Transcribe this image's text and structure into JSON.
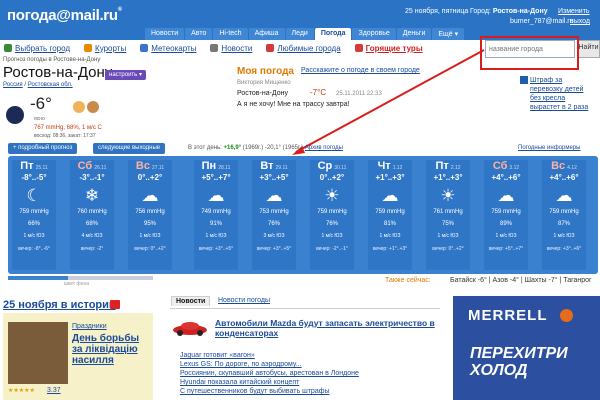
{
  "header": {
    "logo": "погода@mail.ru",
    "date": "25 ноября, пятница",
    "city_label": "Город:",
    "city": "Ростов-на-Дону",
    "change": "Изменить",
    "user": "bumer_787@mail.ru",
    "exit": "выход"
  },
  "tabs": [
    "Новости",
    "Авто",
    "Hi-tech",
    "Афиша",
    "Леди",
    "Погода",
    "Здоровье",
    "Деньги",
    "Ещё ▾"
  ],
  "active_tab": "Погода",
  "subnav": [
    {
      "label": "Выбрать город",
      "icon": "globe-icon",
      "color": "#3a8a3a"
    },
    {
      "label": "Курорты",
      "icon": "palm-icon",
      "color": "#e68a00"
    },
    {
      "label": "Метеокарты",
      "icon": "map-icon",
      "color": "#3a73c8"
    },
    {
      "label": "Новости",
      "icon": "news-icon",
      "color": "#777777"
    },
    {
      "label": "Любимые города",
      "icon": "heart-icon",
      "color": "#d43a3a"
    },
    {
      "label": "Горящие туры",
      "icon": "fire-icon",
      "color": "#d43a3a"
    }
  ],
  "search": {
    "placeholder": "название города",
    "button": "Найти"
  },
  "location": {
    "crumb": "Прогноз погоды в Ростове-на-Дону",
    "name": "Ростов-на-Дону",
    "settings": "настроить ▾",
    "region1": "Россия",
    "region2": "Ростовская обл."
  },
  "current": {
    "temp": "-6°",
    "condition": "ясно",
    "pressure": "767 mmHg, 68%, 1 м/с С",
    "sun": "восход: 08:36, закат: 17:37"
  },
  "my_weather": {
    "title": "Моя погода",
    "link": "Расскажите о погоде в своем городе",
    "user": "Виктория Мищенко",
    "city": "Ростов-на-Дону",
    "temp": "-7°С",
    "time": "25.11.2011 22:33",
    "quote": "А я не хочу! Мне на трассу завтра!"
  },
  "banner": {
    "text": "Штраф за перевозку детей без кресла вырастет в 2 раза"
  },
  "buttons": {
    "detailed": "+ подробный прогноз",
    "weekend": "следующие выходные"
  },
  "day_note": {
    "prefix": "В этот день:",
    "max": "+16,9°",
    "max_year": "(1969г.)",
    "min": "-20,1°",
    "min_year": "(1965г.)",
    "archive": "Архив погоды"
  },
  "informers": "Погодные информеры",
  "days": [
    {
      "name": "Пт",
      "date": "25.11",
      "temp": "-8°..-5°",
      "icon": "☾",
      "pressure": "759 mmHg",
      "humidity": "66%",
      "wind": "1 м/с ЮЗ",
      "evening": "вечер: -8°..-6°",
      "weekend": false
    },
    {
      "name": "Сб",
      "date": "26.11",
      "temp": "-3°..-1°",
      "icon": "❄",
      "pressure": "760 mmHg",
      "humidity": "68%",
      "wind": "4 м/с ЮЗ",
      "evening": "вечер: -2°",
      "weekend": true
    },
    {
      "name": "Вс",
      "date": "27.11",
      "temp": "0°..+2°",
      "icon": "☁",
      "pressure": "756 mmHg",
      "humidity": "95%",
      "wind": "1 м/с ЮЗ",
      "evening": "вечер: 0°..+2°",
      "weekend": true
    },
    {
      "name": "Пн",
      "date": "28.11",
      "temp": "+5°..+7°",
      "icon": "☁",
      "pressure": "749 mmHg",
      "humidity": "91%",
      "wind": "1 м/с ЮЗ",
      "evening": "вечер: +3°..+5°",
      "weekend": false
    },
    {
      "name": "Вт",
      "date": "29.11",
      "temp": "+3°..+5°",
      "icon": "☁",
      "pressure": "753 mmHg",
      "humidity": "76%",
      "wind": "3 м/с ЮЗ",
      "evening": "вечер: +3°..+5°",
      "weekend": false
    },
    {
      "name": "Ср",
      "date": "30.11",
      "temp": "0°..+2°",
      "icon": "☀",
      "pressure": "759 mmHg",
      "humidity": "76%",
      "wind": "1 м/с ЮЗ",
      "evening": "вечер: -2°..-1°",
      "weekend": false
    },
    {
      "name": "Чт",
      "date": "1.12",
      "temp": "+1°..+3°",
      "icon": "☁",
      "pressure": "759 mmHg",
      "humidity": "81%",
      "wind": "1 м/с ЮЗ",
      "evening": "вечер: +1°..+3°",
      "weekend": false
    },
    {
      "name": "Пт",
      "date": "2.12",
      "temp": "+1°..+3°",
      "icon": "☀",
      "pressure": "761 mmHg",
      "humidity": "75%",
      "wind": "1 м/с ЮЗ",
      "evening": "вечер: 0°..+2°",
      "weekend": false
    },
    {
      "name": "Сб",
      "date": "3.12",
      "temp": "+4°..+6°",
      "icon": "☁",
      "pressure": "759 mmHg",
      "humidity": "89%",
      "wind": "1 м/с ЮЗ",
      "evening": "вечер: +5°..+7°",
      "weekend": true
    },
    {
      "name": "Вс",
      "date": "4.12",
      "temp": "+4°..+6°",
      "icon": "☁",
      "pressure": "759 mmHg",
      "humidity": "87%",
      "wind": "1 м/с ЮЗ",
      "evening": "вечер: +3°..+6°",
      "weekend": true
    }
  ],
  "scale": "шкет фона",
  "also": {
    "label": "Также сейчас:",
    "items": "Батайск -6° | Азов -4° | Шахты -7° | Таганрог"
  },
  "history": {
    "title": "25 ноября в истории",
    "category": "Праздники",
    "headline": "День борьбы за ліквідацію насилля",
    "rating": "3.37"
  },
  "news": {
    "tab1": "Новости",
    "tab2": "Новости погоды",
    "main": "Автомобили Mazda будут запасать электричество в конденсаторах",
    "items": [
      "Jaguar готовит «вагон»",
      "Lexus GS: По дороге, по аэродрому...",
      "Россиянин, скупавший автобусы, арестован в Лондоне",
      "Hyundai показала китайский концепт",
      "С путешественников будут выбивать штрафы"
    ]
  },
  "ad": {
    "brand": "MERRELL",
    "slogan": "ПЕРЕХИТРИ ХОЛОД"
  }
}
